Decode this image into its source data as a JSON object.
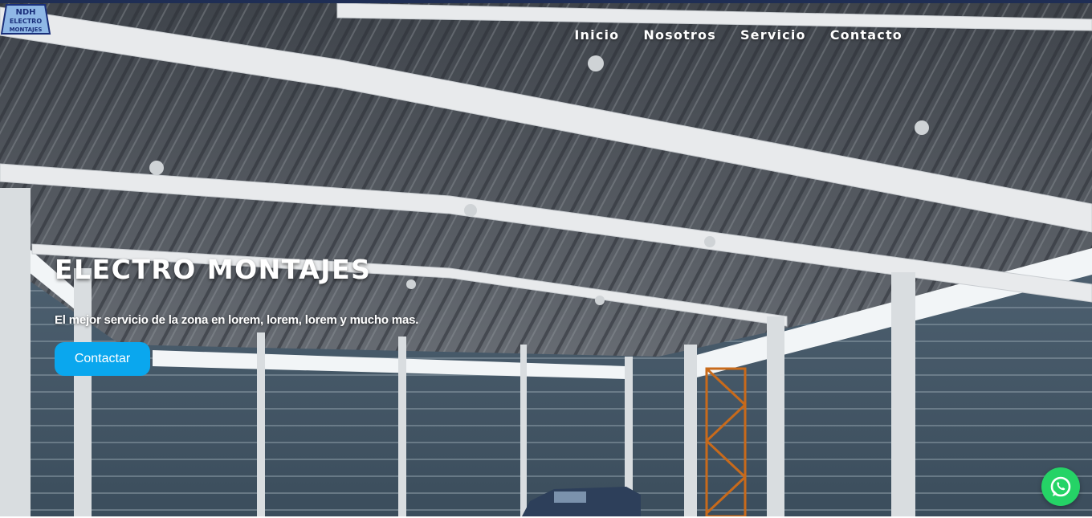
{
  "brand": {
    "logo_text_top": "NDH",
    "logo_text_mid": "ELECTRO",
    "logo_text_bottom": "MONTAJES"
  },
  "nav": {
    "items": [
      {
        "label": "Inicio"
      },
      {
        "label": "Nosotros"
      },
      {
        "label": "Servicio"
      },
      {
        "label": "Contacto"
      }
    ]
  },
  "hero": {
    "title": "ELECTRO MONTAJES",
    "subtitle": "El mejor servicio de la zona en lorem, lorem, lorem y mucho mas.",
    "cta_label": "Contactar"
  },
  "colors": {
    "accent": "#0aa7ee",
    "top_bar": "#1f2e55",
    "whatsapp": "#25d366"
  },
  "icons": {
    "floating": "whatsapp-icon"
  }
}
